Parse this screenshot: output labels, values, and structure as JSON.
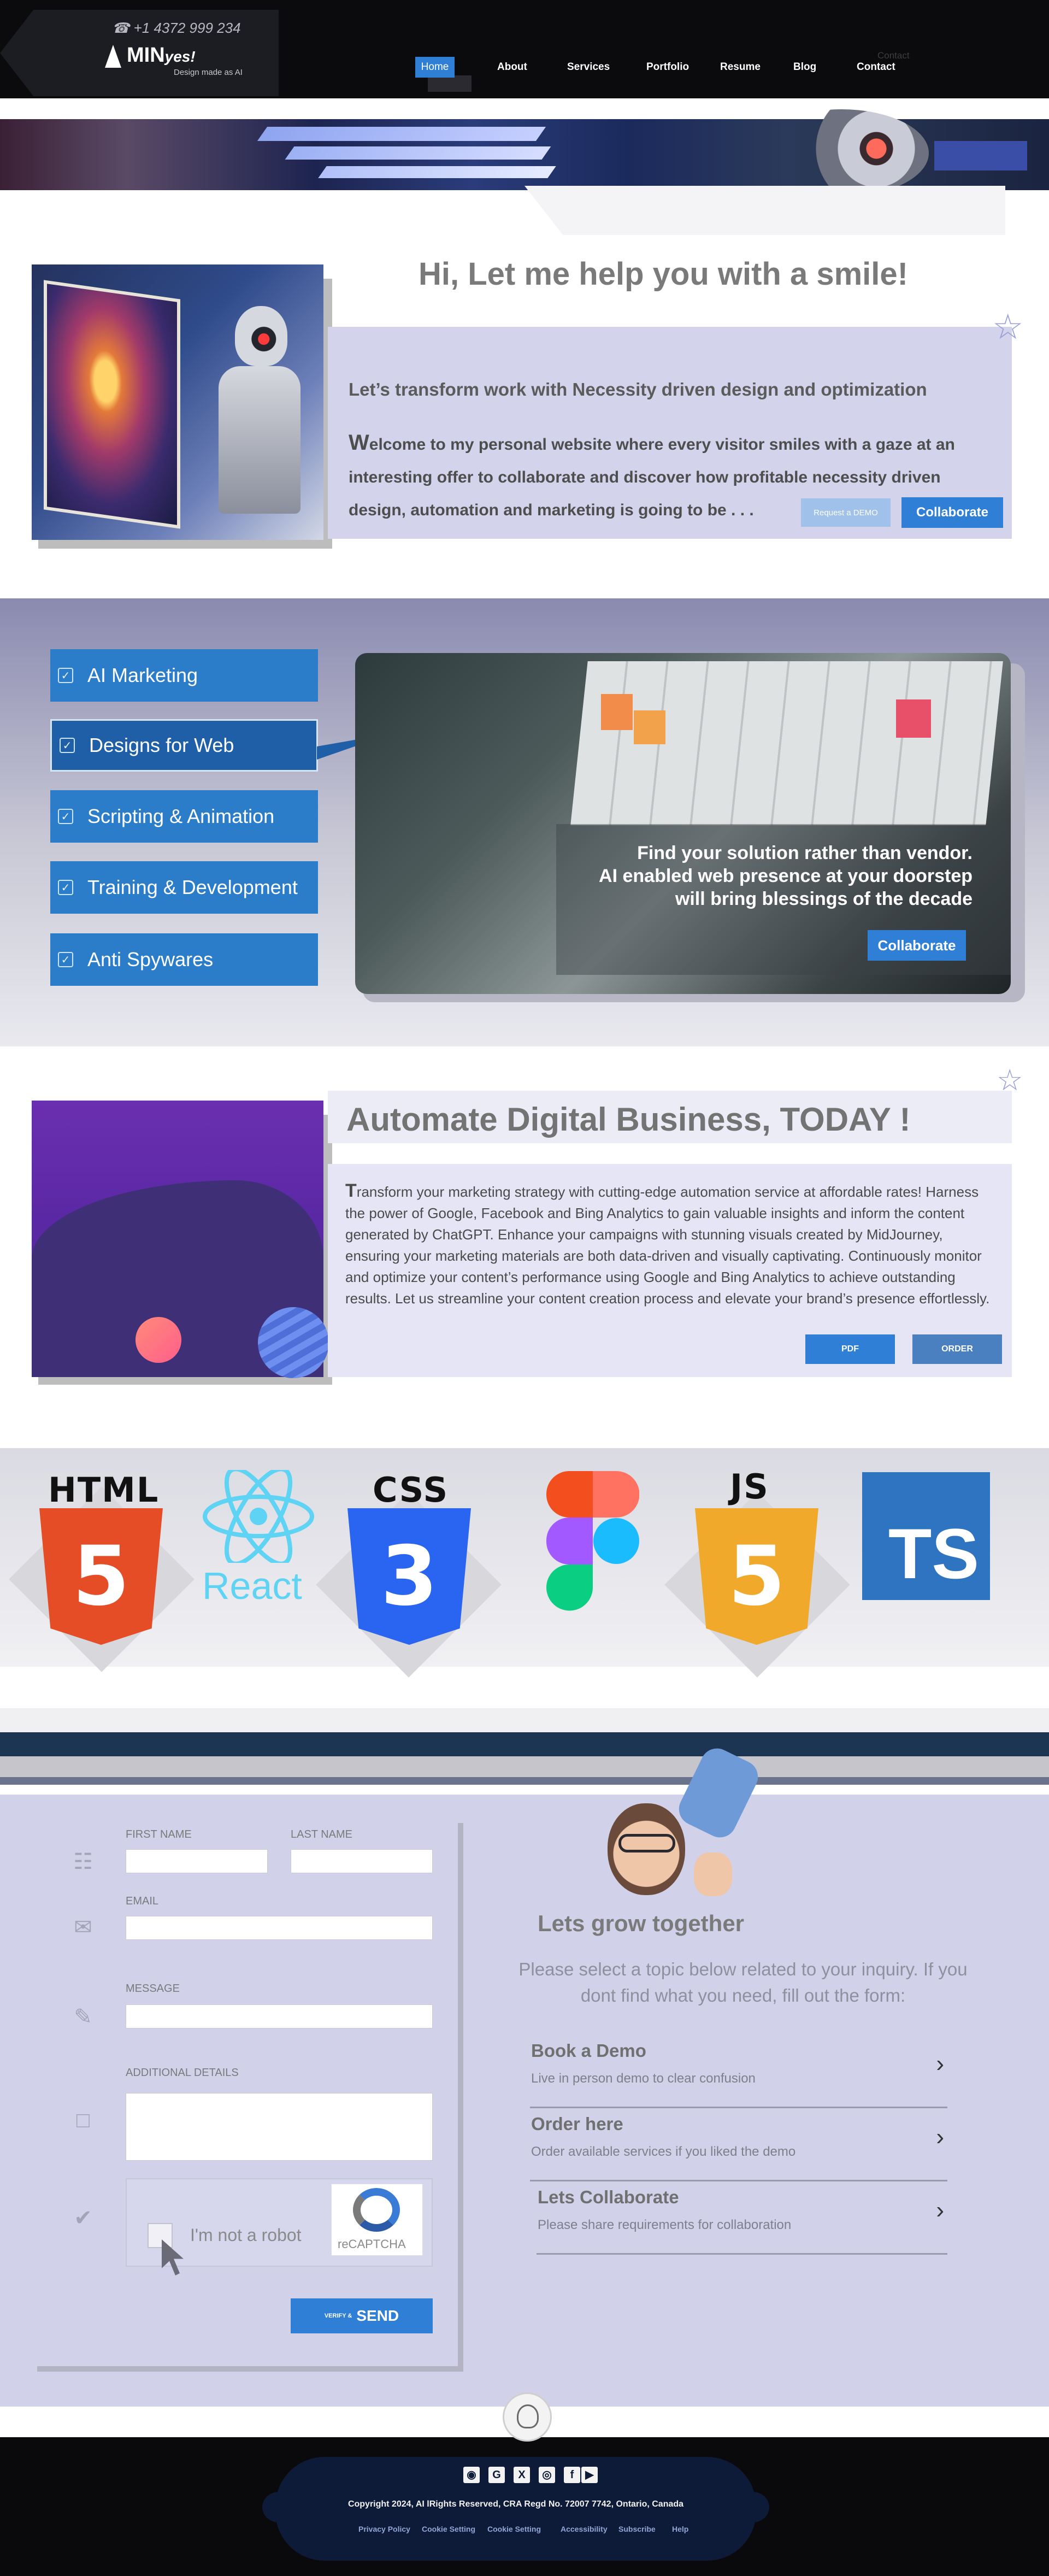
{
  "header": {
    "phone": "+1 4372 999 234",
    "logo_main": "MIN",
    "logo_suffix": "yes!",
    "logo_tagline": "Design made as AI",
    "nav": [
      "Home",
      "About",
      "Services",
      "Portfolio",
      "Resume",
      "Blog",
      "Contact"
    ],
    "ghost_contact": "Contact"
  },
  "hero": {
    "title": "Hi, Let me help you with a smile!",
    "subtitle": "Let’s transform work with  Necessity driven design and optimization",
    "body": "Welcome to my personal website where every visitor smiles with a gaze at an interesting offer to collaborate and discover how profitable necessity driven design, automation and marketing is going to be . . .",
    "demo_button": "Request a DEMO",
    "collaborate_button": "Collaborate"
  },
  "services": {
    "items": [
      "AI Marketing",
      "Designs for Web",
      "Scripting & Animation",
      "Training & Development",
      "Anti Spywares"
    ],
    "active_index": 1,
    "caption": [
      "Find your solution rather than vendor.",
      "AI enabled web presence at your doorstep",
      "will bring blessings of the decade"
    ],
    "collaborate_button": "Collaborate"
  },
  "automate": {
    "title": "Automate Digital Business, TODAY !",
    "body": "Transform your marketing strategy with cutting-edge automation service at affordable rates! Harness the power of Google, Facebook and Bing Analytics to gain valuable insights and inform the content generated by ChatGPT. Enhance your campaigns with stunning visuals created by MidJourney, ensuring your marketing materials are both data-driven and visually captivating. Continuously monitor and optimize your content’s performance using Google and Bing Analytics to achieve outstanding results. Let us streamline your content creation process and elevate your brand’s presence effortlessly.",
    "pdf_button": "PDF",
    "order_button": "ORDER"
  },
  "tech": {
    "html_label": "HTML",
    "html_glyph": "5",
    "react_label": "React",
    "css_label": "CSS",
    "css_glyph": "3",
    "js_label": "JS",
    "js_glyph": "5",
    "ts_label": "TS",
    "colors": {
      "html": "#e44d26",
      "css": "#2965f1",
      "js": "#f0a92a",
      "ts": "#2f74c0",
      "react": "#5fd3f3"
    }
  },
  "form": {
    "first_name_label": "FIRST NAME",
    "last_name_label": "LAST NAME",
    "email_label": "EMAIL",
    "message_label": "MESSAGE",
    "additional_label": "ADDITIONAL DETAILS",
    "captcha_text": "I'm not a robot",
    "captcha_brand": "reCAPTCHA",
    "send_small": "VERIFY &",
    "send_large": "SEND",
    "icons": [
      "contact-card-icon",
      "envelope-icon",
      "pencil-icon",
      "chat-bubble-icon",
      "shield-check-icon"
    ]
  },
  "grow": {
    "title": "Lets grow together",
    "subtitle": "Please select a topic below related to your inquiry. If you dont find what you need, fill out the form:",
    "topics": [
      {
        "title": "Book a Demo",
        "desc": "Live in person demo to clear confusion"
      },
      {
        "title": "Order here",
        "desc": "Order available services if you liked the demo"
      },
      {
        "title": "Lets Collaborate",
        "desc": "Please share requirements for collaboration"
      }
    ]
  },
  "footer": {
    "social": [
      "instagram-icon",
      "google-icon",
      "x-icon",
      "camera-icon",
      "facebook-icon",
      "youtube-icon"
    ],
    "copyright": "Copyright 2024, AI lRights Reserved, CRA Regd No.  72007 7742, Ontario, Canada",
    "links": [
      "Privacy Policy",
      "Cookie Setting",
      "Cookie Setting",
      "Accessibility",
      "Subscribe",
      "Help"
    ]
  }
}
